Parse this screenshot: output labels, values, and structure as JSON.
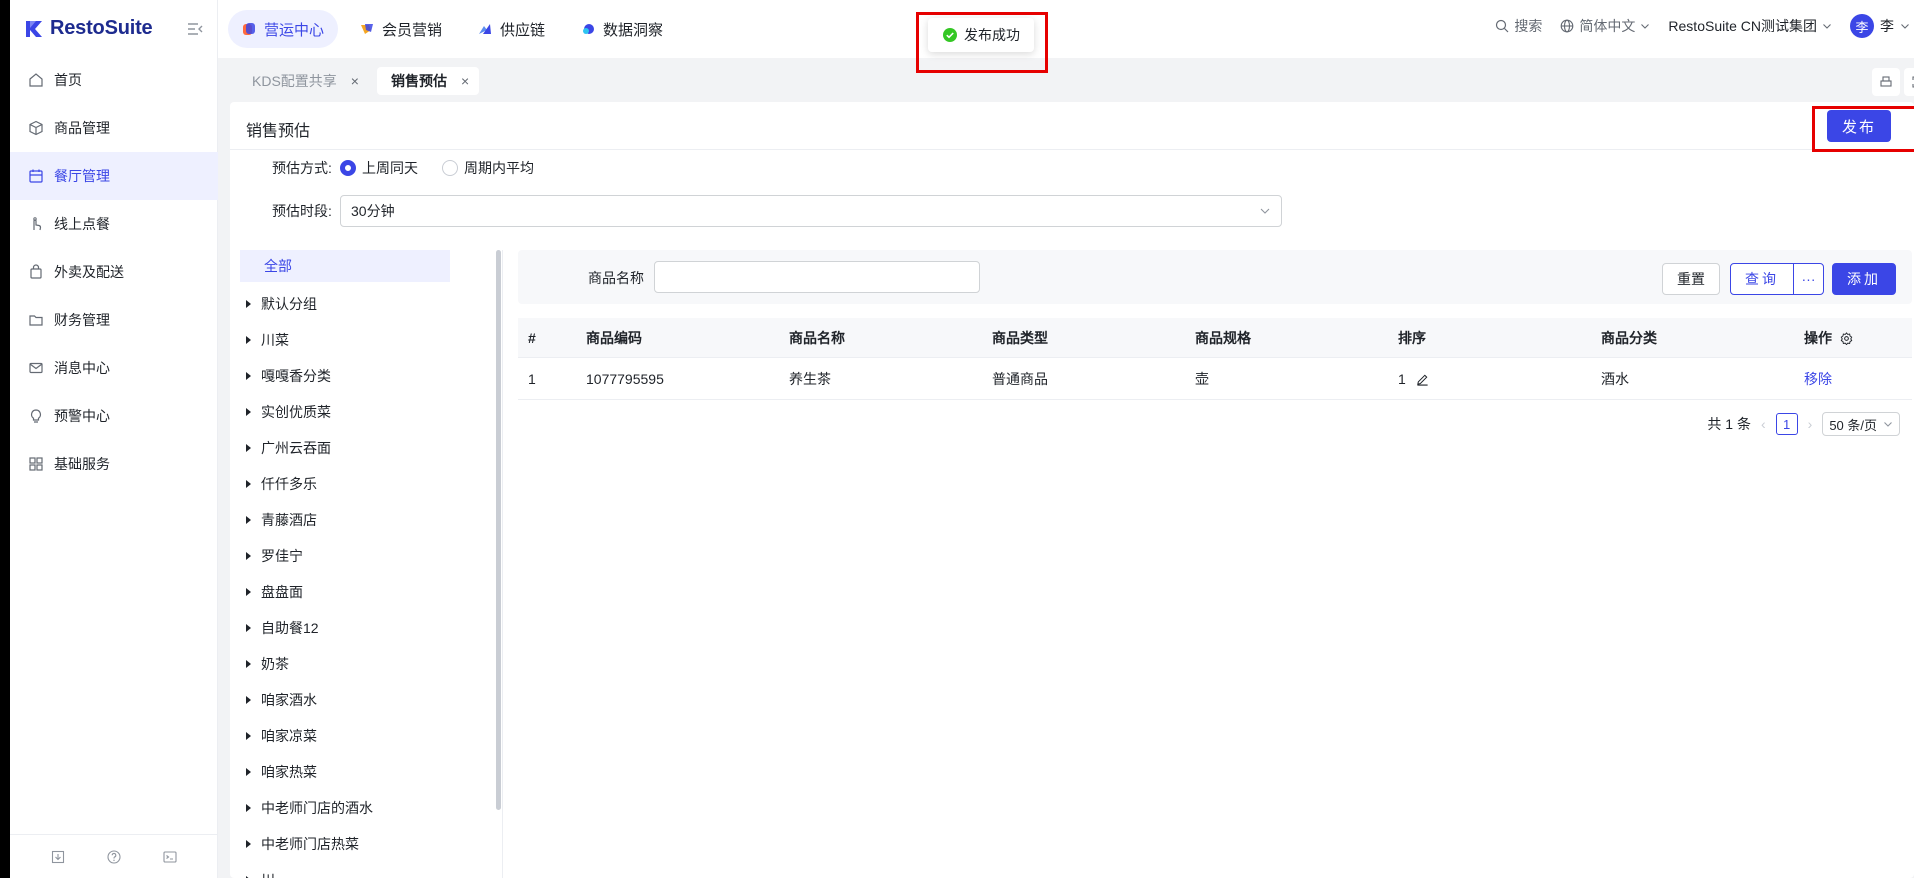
{
  "brand": {
    "name": "RestoSuite",
    "color": "#1d2b8f"
  },
  "accent": "#3b46e6",
  "sidebar": {
    "items": [
      {
        "label": "首页",
        "icon": "home-icon",
        "active": false
      },
      {
        "label": "商品管理",
        "icon": "cube-icon",
        "active": false
      },
      {
        "label": "餐厅管理",
        "icon": "calendar-icon",
        "active": true
      },
      {
        "label": "线上点餐",
        "icon": "hand-icon",
        "active": false
      },
      {
        "label": "外卖及配送",
        "icon": "bag-icon",
        "active": false
      },
      {
        "label": "财务管理",
        "icon": "folder-icon",
        "active": false
      },
      {
        "label": "消息中心",
        "icon": "mail-icon",
        "active": false
      },
      {
        "label": "预警中心",
        "icon": "bulb-icon",
        "active": false
      },
      {
        "label": "基础服务",
        "icon": "grid-icon",
        "active": false
      }
    ]
  },
  "topbar": {
    "tabs": [
      {
        "label": "营运中心",
        "active": true
      },
      {
        "label": "会员营销",
        "active": false
      },
      {
        "label": "供应链",
        "active": false
      },
      {
        "label": "数据洞察",
        "active": false
      }
    ],
    "search": "搜索",
    "language": "简体中文",
    "org": "RestoSuite CN测试集团",
    "avatar": "李",
    "user": "李"
  },
  "toast": {
    "text": "发布成功"
  },
  "page_tabs": [
    {
      "label": "KDS配置共享",
      "close": "×"
    },
    {
      "label": "销售预估",
      "close": "×"
    }
  ],
  "card": {
    "title": "销售预估",
    "publish": "发布"
  },
  "form": {
    "method_label": "预估方式:",
    "method_options": [
      "上周同天",
      "周期内平均"
    ],
    "period_label": "预估时段:",
    "period_value": "30分钟"
  },
  "tree": {
    "all": "全部",
    "items": [
      "默认分组",
      "川菜",
      "嘎嘎香分类",
      "实创优质菜",
      "广州云吞面",
      "仟仟多乐",
      "青藤酒店",
      "罗佳宁",
      "盘盘面",
      "自助餐12",
      "奶茶",
      "咱家酒水",
      "咱家凉菜",
      "咱家热菜",
      "中老师门店的酒水",
      "中老师门店热菜",
      "川"
    ]
  },
  "filter": {
    "name_label": "商品名称",
    "reset": "重置",
    "query": "查询",
    "more": "···",
    "add": "添加"
  },
  "table": {
    "headers": [
      "#",
      "商品编码",
      "商品名称",
      "商品类型",
      "商品规格",
      "排序",
      "商品分类",
      "操作"
    ],
    "rows": [
      {
        "idx": "1",
        "code": "1077795595",
        "name": "养生茶",
        "type": "普通商品",
        "spec": "壶",
        "sort": "1",
        "category": "酒水",
        "action": "移除"
      }
    ]
  },
  "pager": {
    "total": "共 1 条",
    "page": "1",
    "size": "50 条/页"
  }
}
